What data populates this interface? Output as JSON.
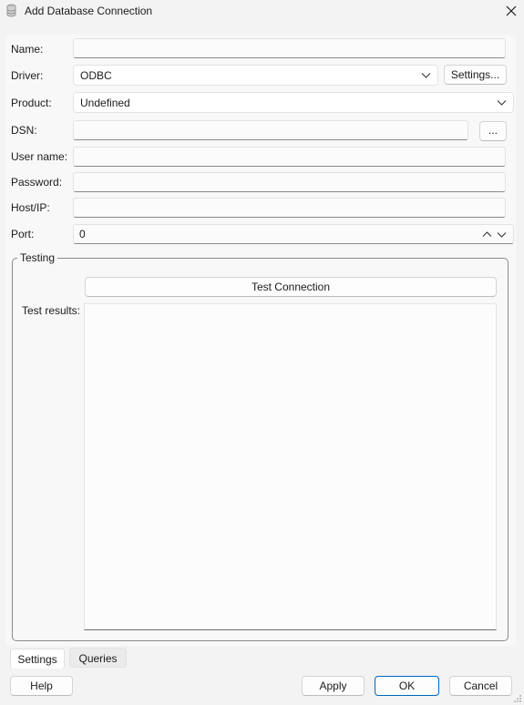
{
  "window": {
    "title": "Add Database Connection",
    "icon": "database-icon",
    "close_icon": "close-icon"
  },
  "form": {
    "name": {
      "label": "Name:",
      "value": ""
    },
    "driver": {
      "label": "Driver:",
      "value": "ODBC",
      "settings_button": "Settings..."
    },
    "product": {
      "label": "Product:",
      "value": "Undefined"
    },
    "dsn": {
      "label": "DSN:",
      "value": "",
      "browse_button": "..."
    },
    "username": {
      "label": "User name:",
      "value": ""
    },
    "password": {
      "label": "Password:",
      "value": ""
    },
    "host": {
      "label": "Host/IP:",
      "value": ""
    },
    "port": {
      "label": "Port:",
      "value": "0"
    }
  },
  "testing": {
    "group_title": "Testing",
    "test_button": "Test Connection",
    "results_label": "Test results:",
    "results_text": ""
  },
  "tabs": [
    {
      "label": "Settings",
      "active": true
    },
    {
      "label": "Queries",
      "active": false
    }
  ],
  "buttons": {
    "help": "Help",
    "apply": "Apply",
    "ok": "OK",
    "cancel": "Cancel"
  },
  "colors": {
    "accent": "#0067c0",
    "background": "#f3f3f3"
  }
}
